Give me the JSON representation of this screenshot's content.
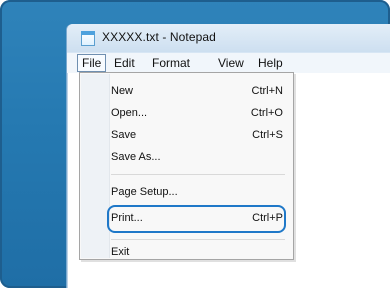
{
  "window": {
    "title": "XXXXX.txt - Notepad",
    "app_icon": "notepad-icon"
  },
  "menubar": {
    "items": [
      {
        "label": "File"
      },
      {
        "label": "Edit"
      },
      {
        "label": "Format"
      },
      {
        "label": "View"
      },
      {
        "label": "Help"
      }
    ]
  },
  "file_menu": {
    "items": [
      {
        "label": "New",
        "shortcut": "Ctrl+N"
      },
      {
        "label": "Open...",
        "shortcut": "Ctrl+O"
      },
      {
        "label": "Save",
        "shortcut": "Ctrl+S"
      },
      {
        "label": "Save As...",
        "shortcut": ""
      },
      {
        "label": "Page Setup...",
        "shortcut": ""
      },
      {
        "label": "Print...",
        "shortcut": "Ctrl+P"
      },
      {
        "label": "Exit",
        "shortcut": ""
      }
    ],
    "highlight_color": "#1f78c8"
  },
  "colors": {
    "desktop": "#2579b1"
  }
}
